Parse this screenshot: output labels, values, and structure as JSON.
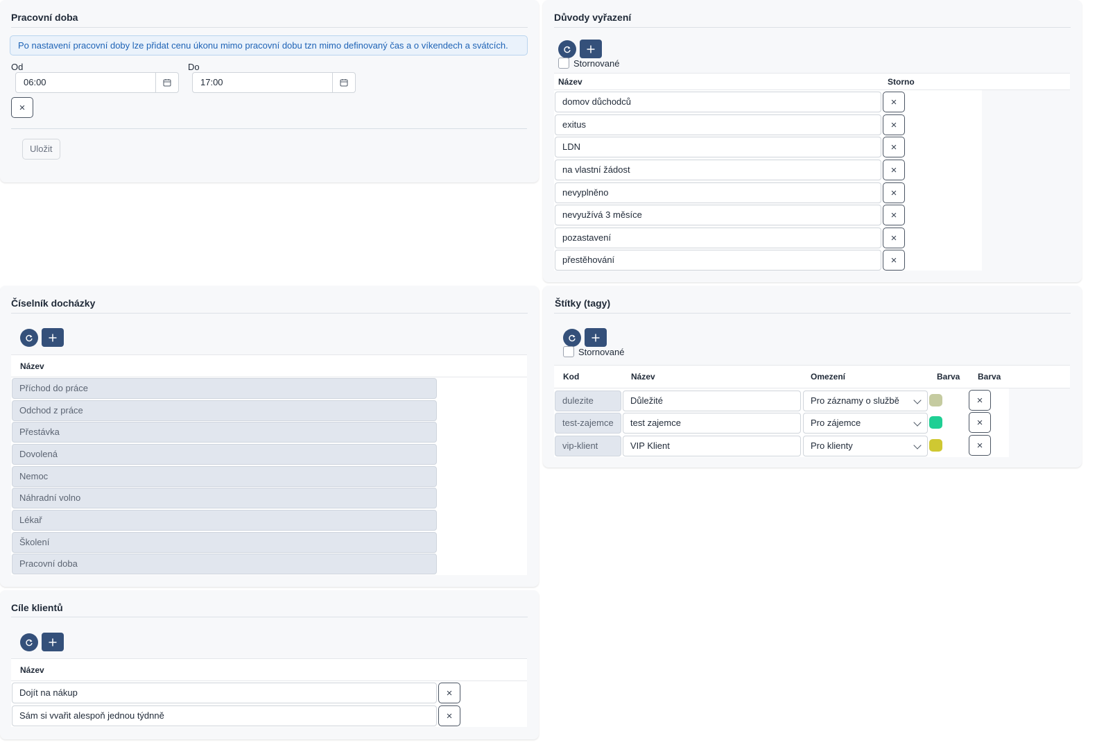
{
  "work_hours": {
    "title": "Pracovní doba",
    "info": "Po nastavení pracovní doby lze přidat cenu úkonu mimo pracovní dobu tzn mimo definovaný čas a o víkendech a svátcích.",
    "from_label": "Od",
    "from_value": "06:00",
    "to_label": "Do",
    "to_value": "17:00",
    "clear_icon": "×",
    "save_label": "Uložit"
  },
  "discharge_reasons": {
    "title": "Důvody vyřazení",
    "cancelled_label": "Stornované",
    "col_name": "Název",
    "col_storno": "Storno",
    "rows": [
      {
        "name": "domov důchodců"
      },
      {
        "name": "exitus"
      },
      {
        "name": "LDN"
      },
      {
        "name": "na vlastní žádost"
      },
      {
        "name": "nevyplněno"
      },
      {
        "name": "nevyužívá 3 měsíce"
      },
      {
        "name": "pozastavení"
      },
      {
        "name": "přestěhování"
      }
    ]
  },
  "attendance_codes": {
    "title": "Číselník docházky",
    "col_name": "Název",
    "rows": [
      {
        "name": "Příchod do práce"
      },
      {
        "name": "Odchod z práce"
      },
      {
        "name": "Přestávka"
      },
      {
        "name": "Dovolená"
      },
      {
        "name": "Nemoc"
      },
      {
        "name": "Náhradní volno"
      },
      {
        "name": "Lékař"
      },
      {
        "name": "Školení"
      },
      {
        "name": "Pracovní doba"
      }
    ]
  },
  "tags": {
    "title": "Štítky (tagy)",
    "cancelled_label": "Stornované",
    "col_code": "Kod",
    "col_name": "Název",
    "col_restriction": "Omezení",
    "col_color": "Barva",
    "col_color2": "Barva",
    "rows": [
      {
        "code": "dulezite",
        "name": "Důležité",
        "restriction": "Pro záznamy o službě",
        "color": "#c5cba0"
      },
      {
        "code": "test-zajemce",
        "name": "test zajemce",
        "restriction": "Pro zájemce",
        "color": "#1fcf94"
      },
      {
        "code": "vip-klient",
        "name": "VIP Klient",
        "restriction": "Pro klienty",
        "color": "#cfc832"
      }
    ]
  },
  "client_goals": {
    "title": "Cíle klientů",
    "col_name": "Název",
    "rows": [
      {
        "name": "Dojít na nákup"
      },
      {
        "name": "Sám si vvařit alespoň jednou týdnně"
      }
    ]
  },
  "icons": {
    "refresh": "refresh-icon",
    "add": "plus-icon",
    "calendar": "calendar-icon",
    "close": "close-icon",
    "chevron": "chevron-down-icon"
  },
  "colors": {
    "primary_button": "#34507a",
    "info_bg": "#eaf2fb",
    "info_text": "#1e63b6",
    "readonly_bg": "#e1e6ee"
  }
}
